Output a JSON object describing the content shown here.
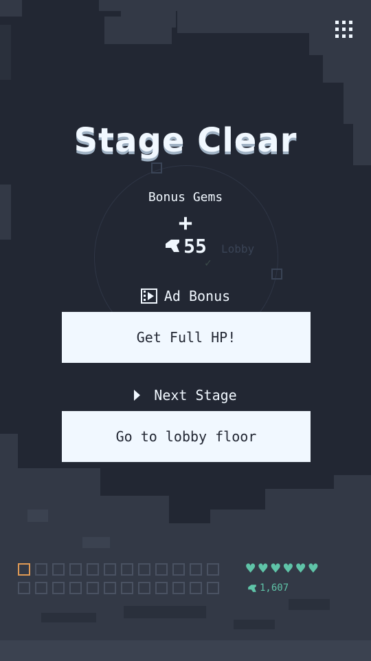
{
  "screen": {
    "title": "Stage Clear",
    "bonus_label": "Bonus Gems",
    "plus_sign": "+",
    "bonus_gems": "55"
  },
  "ad_bonus": {
    "label": "Ad Bonus",
    "button_label": "Get Full HP!"
  },
  "next_stage": {
    "label": "Next Stage",
    "button_label": "Go to lobby floor"
  },
  "background_hint": {
    "label": "Lobby"
  },
  "hud": {
    "hearts": 6,
    "heart_glyph": "♥",
    "gem_total": "1,607",
    "inventory_slots_row1": 12,
    "inventory_slots_row2": 12
  },
  "colors": {
    "background": "#222733",
    "rock": "#333946",
    "text": "#f1f8ff",
    "accent_teal": "#5fc4a8",
    "accent_orange": "#e09a55"
  },
  "icons": {
    "menu": "grid-dots-icon",
    "gem": "gem-icon",
    "ad": "film-icon",
    "next": "play-icon",
    "heart": "heart-icon"
  }
}
